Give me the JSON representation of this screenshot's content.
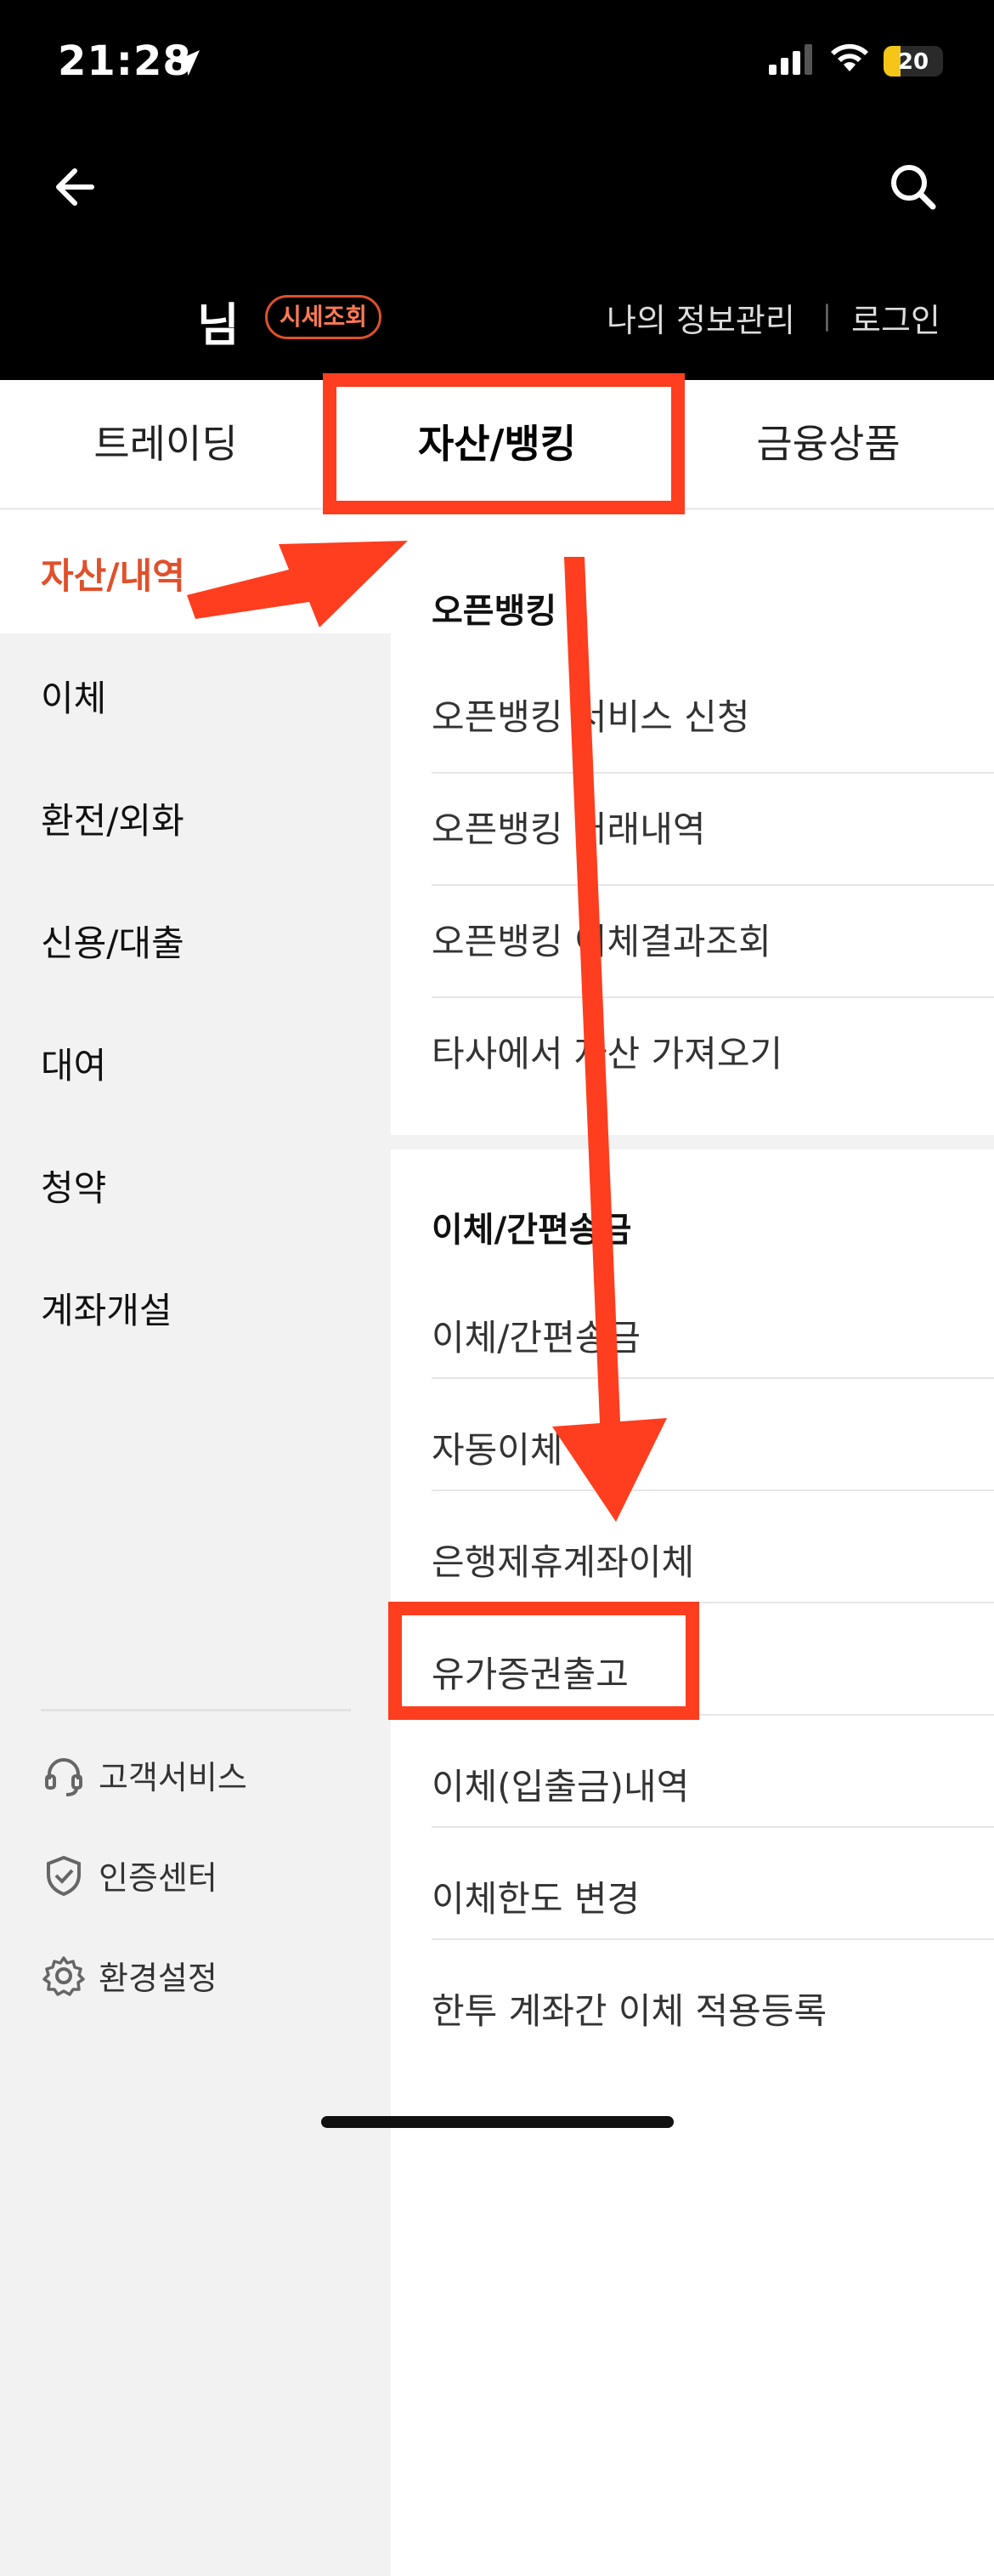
{
  "status": {
    "time": "21:28",
    "battery": "20"
  },
  "header": {
    "user_name": "님",
    "badge": "시세조회",
    "my_info": "나의 정보관리",
    "divider": "|",
    "login": "로그인"
  },
  "tabs": [
    {
      "label": "트레이딩"
    },
    {
      "label": "자산/뱅킹"
    },
    {
      "label": "금융상품"
    }
  ],
  "leftnav": {
    "items": [
      {
        "label": "자산/내역"
      },
      {
        "label": "이체"
      },
      {
        "label": "환전/외화"
      },
      {
        "label": "신용/대출"
      },
      {
        "label": "대여"
      },
      {
        "label": "청약"
      },
      {
        "label": "계좌개설"
      }
    ],
    "footer": [
      {
        "label": "고객서비스",
        "icon": "headset-icon"
      },
      {
        "label": "인증센터",
        "icon": "shield-icon"
      },
      {
        "label": "환경설정",
        "icon": "gear-icon"
      }
    ]
  },
  "sections": [
    {
      "title": "오픈뱅킹",
      "items": [
        {
          "label": "오픈뱅킹 서비스 신청"
        },
        {
          "label": "오픈뱅킹 거래내역"
        },
        {
          "label": "오픈뱅킹 이체결과조회"
        },
        {
          "label": "타사에서 자산 가져오기"
        }
      ]
    },
    {
      "title": "이체/간편송금",
      "items": [
        {
          "label": "이체/간편송금"
        },
        {
          "label": "자동이체"
        },
        {
          "label": "은행제휴계좌이체"
        },
        {
          "label": "유가증권출고"
        },
        {
          "label": "이체(입출금)내역"
        },
        {
          "label": "이체한도 변경"
        },
        {
          "label": "한투 계좌간 이체 적용등록"
        }
      ]
    }
  ],
  "colors": {
    "accent": "#e0502b",
    "annotation": "#ff3d1f"
  }
}
